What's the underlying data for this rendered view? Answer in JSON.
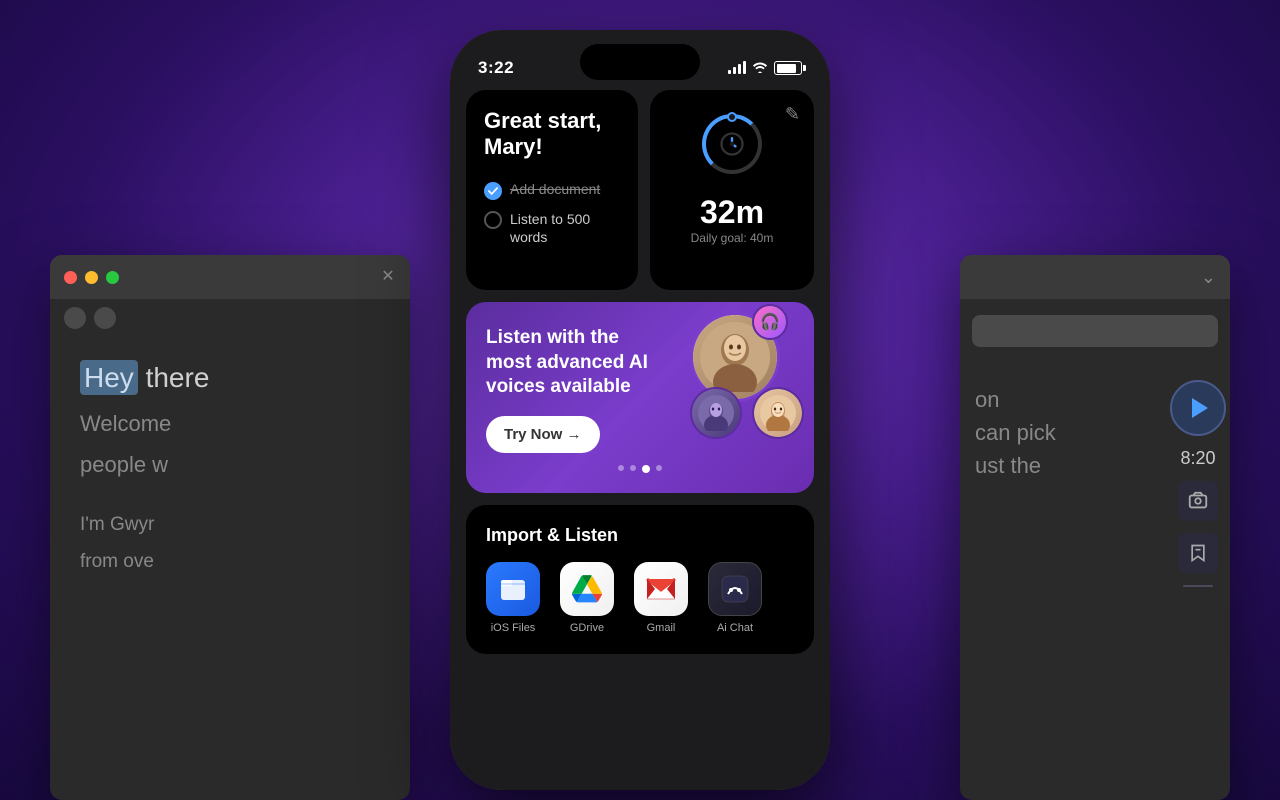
{
  "background": {
    "color_start": "#5b2d9e",
    "color_end": "#1e0a4a"
  },
  "status_bar": {
    "time": "3:22",
    "signal_label": "Signal",
    "wifi_label": "WiFi",
    "battery_label": "Battery"
  },
  "greeting_widget": {
    "title": "Great start, Mary!",
    "task1": {
      "text": "Add document",
      "done": true
    },
    "task2": {
      "line1": "Listen to 500",
      "line2": "words",
      "done": false
    }
  },
  "timer_widget": {
    "value": "32m",
    "goal_label": "Daily goal: 40m",
    "edit_icon": "✎"
  },
  "banner": {
    "text": "Listen with the most advanced AI voices available",
    "cta": "Try Now →",
    "dots": [
      "",
      "",
      "active",
      ""
    ],
    "avatar_main_emoji": "👨",
    "avatar_sm1_emoji": "👩‍🦱",
    "avatar_sm2_emoji": "👩🏼",
    "headphone_icon": "🎧"
  },
  "import_section": {
    "title": "Import & Listen",
    "items": [
      {
        "id": "ios-files",
        "label": "iOS Files",
        "icon": "📁"
      },
      {
        "id": "gdrive",
        "label": "GDrive",
        "icon": "gdrive"
      },
      {
        "id": "gmail",
        "label": "Gmail",
        "icon": "gmail"
      },
      {
        "id": "ai-chat",
        "label": "Ai Chat",
        "icon": "aichat"
      }
    ]
  },
  "left_browser": {
    "text_line1_highlight": "Hey",
    "text_line1_rest": " there",
    "text_line2": "Welcome",
    "text_line3": "people w"
  },
  "right_browser": {
    "text_line1": "on",
    "text_line2": "can pick",
    "text_line3": "ust the"
  },
  "right_controls": {
    "time": "8:20"
  }
}
